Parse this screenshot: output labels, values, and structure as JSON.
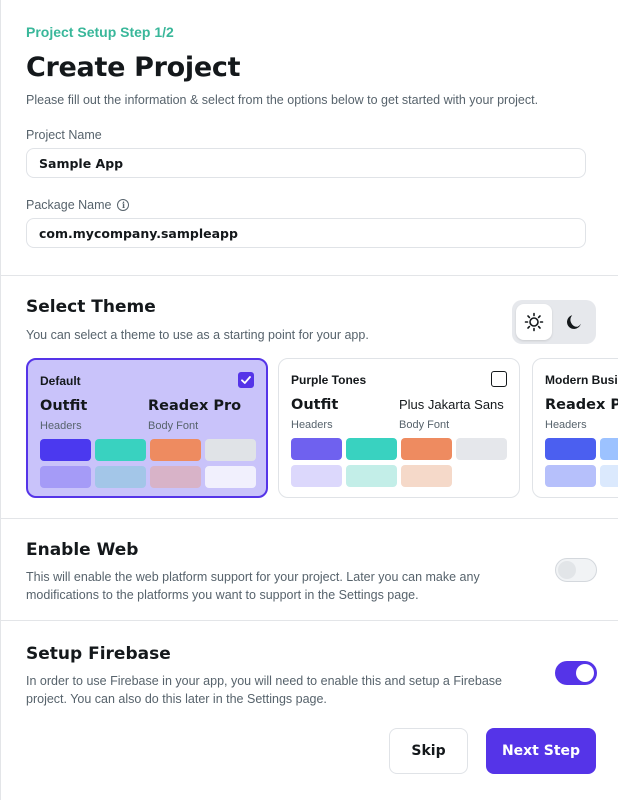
{
  "header": {
    "step_label": "Project Setup Step 1/2",
    "title": "Create Project",
    "subtitle": "Please fill out the information & select from the options below to get started with your project."
  },
  "fields": {
    "project_name": {
      "label": "Project Name",
      "value": "Sample App"
    },
    "package_name": {
      "label": "Package Name",
      "value": "com.mycompany.sampleapp",
      "info_icon": "info-icon"
    }
  },
  "theme_section": {
    "title": "Select Theme",
    "description": "You can select a theme to use as a starting point for your app.",
    "mode_toggle": {
      "light_icon": "sun-icon",
      "dark_icon": "moon-icon",
      "selected": "light"
    },
    "cards": [
      {
        "name": "Default",
        "selected": true,
        "header_font": "Outfit",
        "header_caption": "Headers",
        "body_font": "Readex Pro",
        "body_caption": "Body Font",
        "swatches": [
          "#4b39ef",
          "#39d2c0",
          "#ee8b60",
          "#e0e3e7",
          "#a59bf7",
          "#a3c6e8",
          "#d8b3c8",
          "#f1f0fd"
        ]
      },
      {
        "name": "Purple Tones",
        "selected": false,
        "header_font": "Outfit",
        "header_caption": "Headers",
        "body_font": "Plus Jakarta Sans",
        "body_caption": "Body Font",
        "swatches": [
          "#6f61ef",
          "#39d2c0",
          "#ee8b60",
          "#e5e7eb",
          "#dcd8fc",
          "#c3eee8",
          "#f5d9c9"
        ]
      },
      {
        "name": "Modern Busir",
        "selected": false,
        "header_font": "Readex Pr",
        "header_caption": "Headers",
        "swatches": [
          "#4b5ff0",
          "#9cc2ff",
          "#b6c0fb",
          "#dbe9fd"
        ]
      }
    ]
  },
  "web_section": {
    "title": "Enable Web",
    "description": "This will enable the web platform support for your project. Later you can make any modifications to the platforms you want to support in the Settings page.",
    "enabled": false
  },
  "firebase_section": {
    "title": "Setup Firebase",
    "description": "In order to use Firebase in your app, you will need to enable this and setup a Firebase project. You can also do this later in the Settings page.",
    "enabled": true
  },
  "actions": {
    "skip_label": "Skip",
    "next_label": "Next Step"
  },
  "colors": {
    "accent": "#5534e8",
    "step_label": "#39b79a"
  }
}
